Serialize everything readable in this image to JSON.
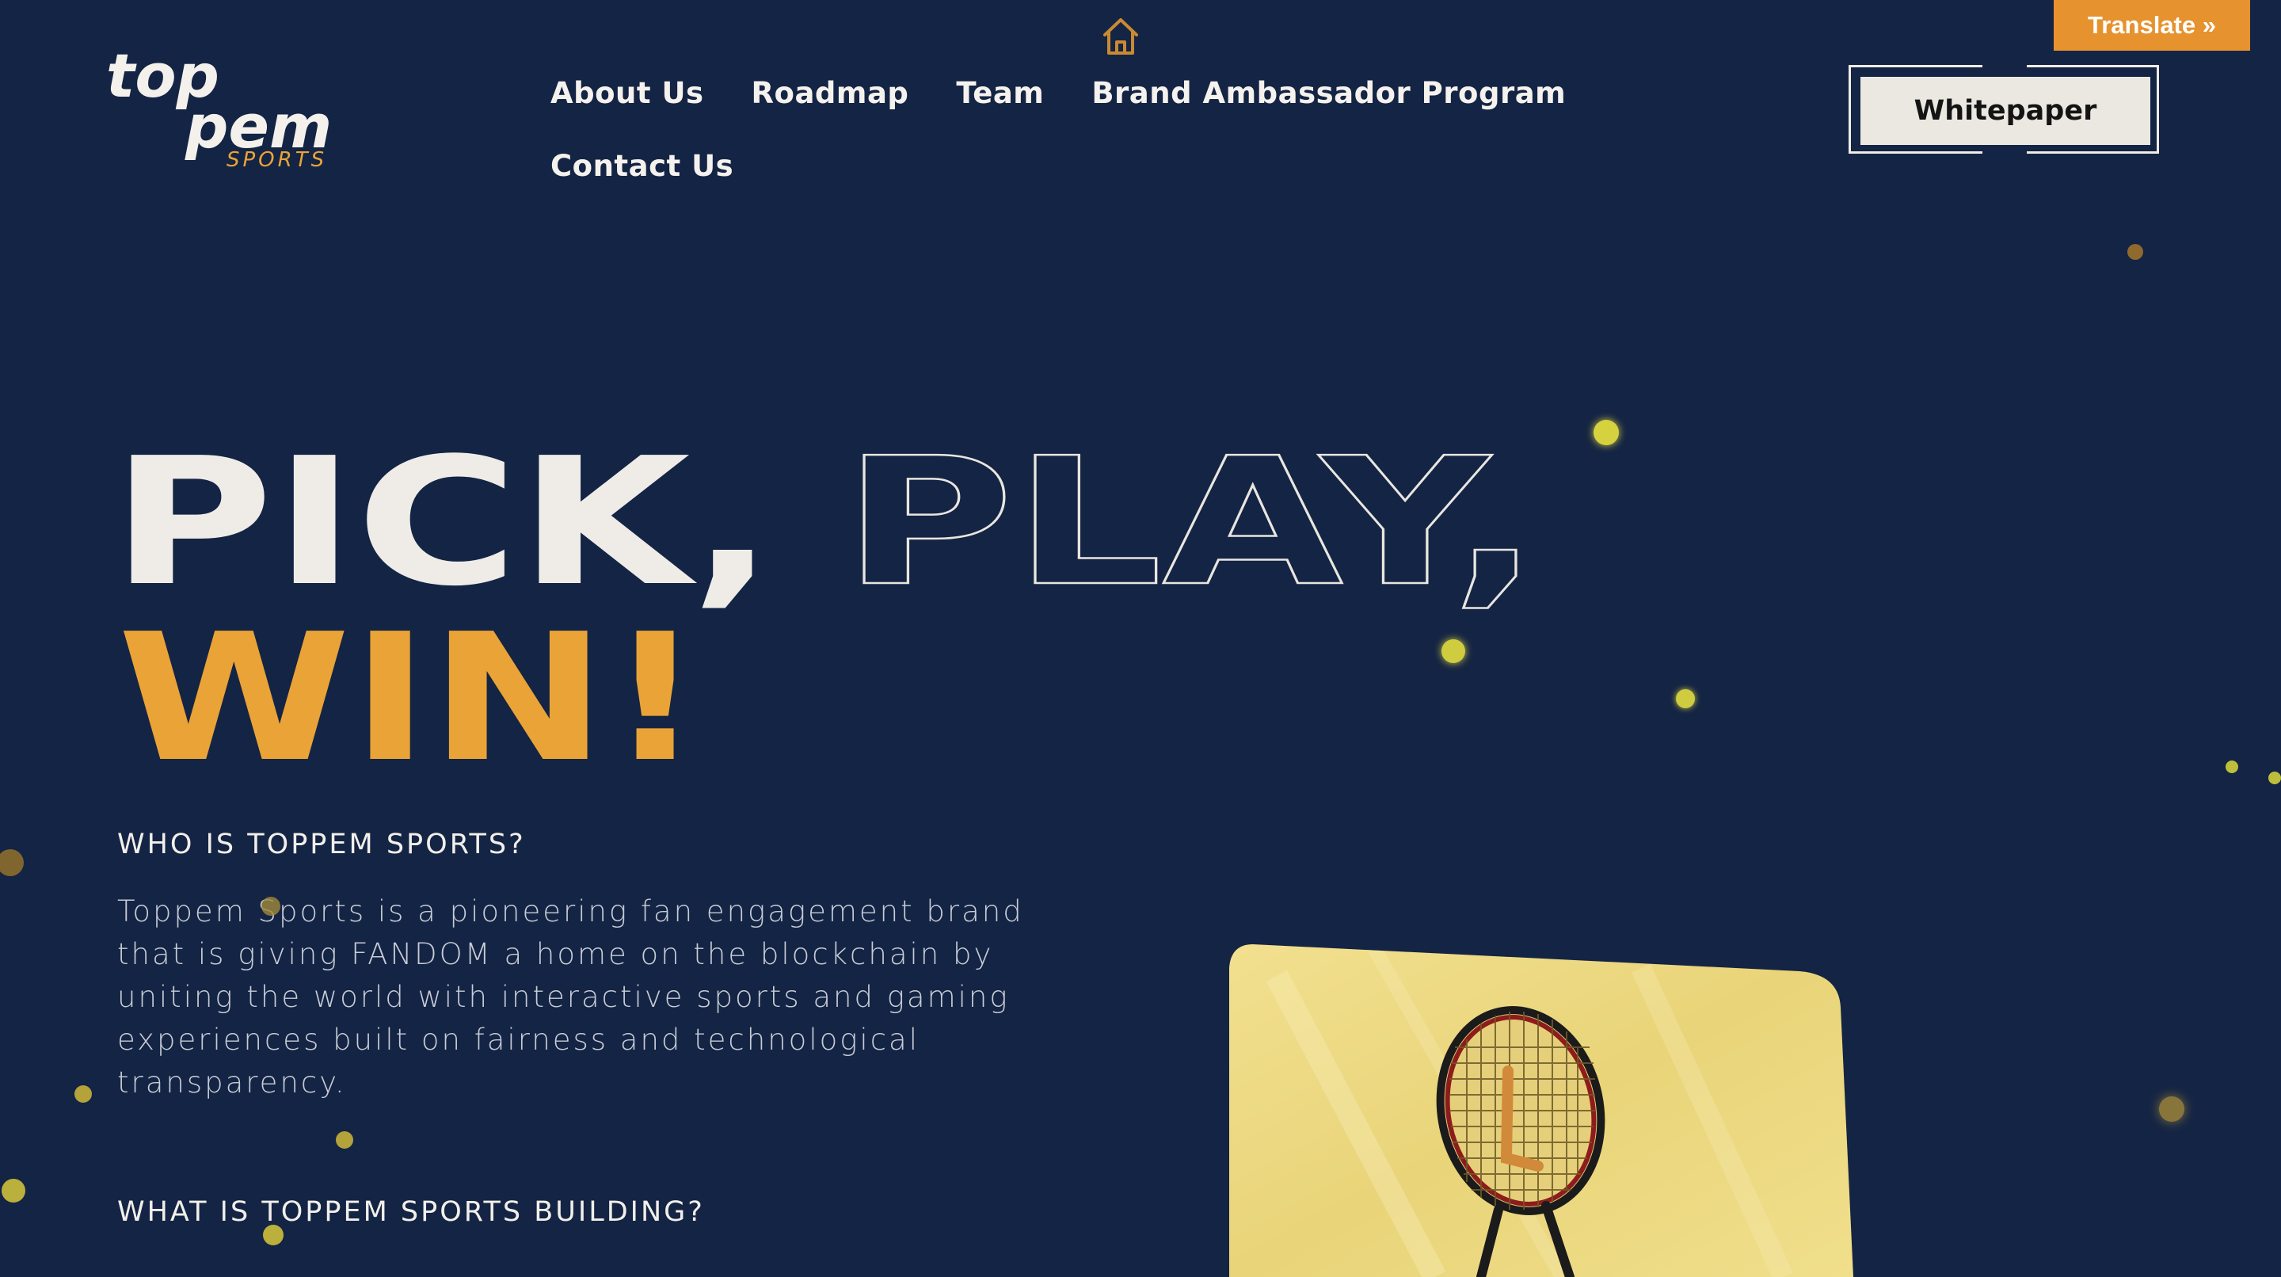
{
  "header": {
    "logo_top": "top",
    "logo_bottom": "pem",
    "logo_sub": "SPORTS",
    "nav": [
      "About Us",
      "Roadmap",
      "Team",
      "Brand Ambassador Program",
      "Contact Us"
    ],
    "cta_label": "Whitepaper",
    "translate_label": "Translate »"
  },
  "hero": {
    "word1": "PICK,",
    "word2": "PLAY,",
    "word3": "WIN!"
  },
  "about": {
    "who_title": "WHO IS TOPPEM SPORTS?",
    "who_body": "Toppem Sports is a pioneering fan engagement brand that is giving FANDOM a home on the blockchain by uniting the world with interactive sports and gaming experiences built on fairness and technological transparency.",
    "what_title": "WHAT IS TOPPEM SPORTS BUILDING?"
  },
  "colors": {
    "background": "#142444",
    "accent": "#eaa337",
    "translate": "#e6922e",
    "text": "#efece8"
  },
  "icons": [
    "home-icon",
    "tennis-racket-icon"
  ]
}
